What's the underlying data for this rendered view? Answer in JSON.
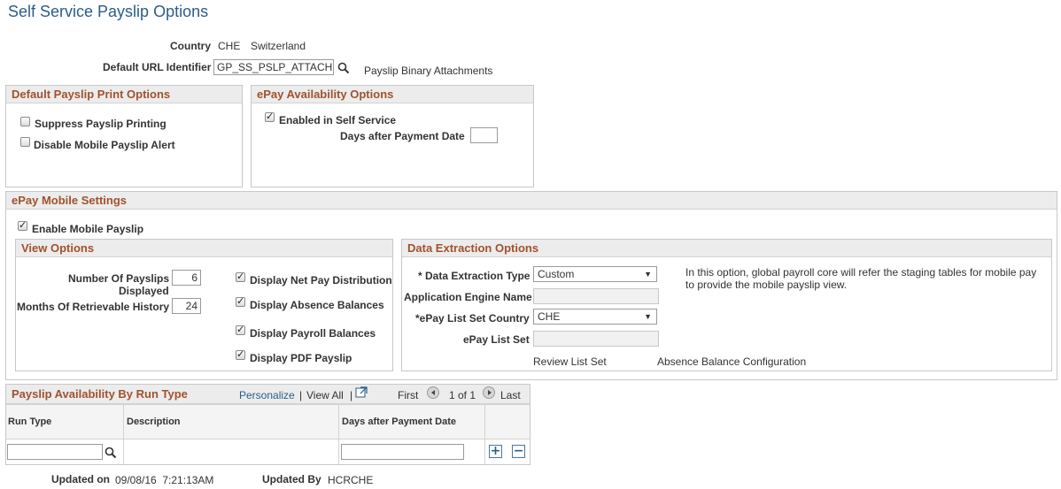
{
  "page_title": "Self Service Payslip Options",
  "header": {
    "country_label": "Country",
    "country_code": "CHE",
    "country_name": "Switzerland",
    "url_label": "Default URL Identifier",
    "url_value": "GP_SS_PSLP_ATTACH",
    "url_description": "Payslip Binary Attachments"
  },
  "print_options": {
    "title": "Default Payslip Print Options",
    "suppress_label": "Suppress Payslip Printing",
    "suppress_checked": false,
    "disable_alert_label": "Disable Mobile Payslip Alert",
    "disable_alert_checked": false
  },
  "availability": {
    "title": "ePay Availability Options",
    "enabled_label": "Enabled in Self Service",
    "enabled_checked": true,
    "days_label": "Days after Payment Date",
    "days_value": ""
  },
  "mobile": {
    "title": "ePay Mobile Settings",
    "enable_label": "Enable Mobile Payslip",
    "enable_checked": true,
    "view": {
      "title": "View Options",
      "num_payslips_label_1": "Number Of Payslips",
      "num_payslips_label_2": "Displayed",
      "num_payslips_value": "6",
      "months_label": "Months Of Retrievable History",
      "months_value": "24",
      "net_pay_label": "Display Net Pay Distribution",
      "absence_label": "Display Absence Balances",
      "payroll_label": "Display Payroll Balances",
      "pdf_label": "Display PDF Payslip"
    },
    "extraction": {
      "title": "Data Extraction Options",
      "type_label": "* Data Extraction Type",
      "type_value": "Custom",
      "info_text": "In this option, global payroll core will refer the staging tables for mobile pay to provide the mobile payslip view.",
      "app_engine_label": "Application Engine Name",
      "app_engine_value": "",
      "list_country_label": "*ePay List Set Country",
      "list_country_value": "CHE",
      "list_set_label": "ePay List Set",
      "list_set_value": "",
      "review_link": "Review List Set",
      "absence_config_link": "Absence Balance Configuration"
    }
  },
  "run_type_grid": {
    "title": "Payslip Availability By Run Type",
    "personalize": "Personalize",
    "view_all": "View All",
    "first": "First",
    "range": "1 of 1",
    "last": "Last",
    "columns": [
      "Run Type",
      "Description",
      "Days after Payment Date"
    ],
    "row": {
      "run_type": "",
      "description": "",
      "days": ""
    }
  },
  "footer": {
    "updated_on_label": "Updated on",
    "updated_on_value": "09/08/16  7:21:13AM",
    "updated_by_label": "Updated By",
    "updated_by_value": "HCRCHE"
  },
  "colors": {
    "title_blue": "#2b5d8a",
    "section_brown": "#a0522d",
    "header_gray": "#ececec"
  }
}
